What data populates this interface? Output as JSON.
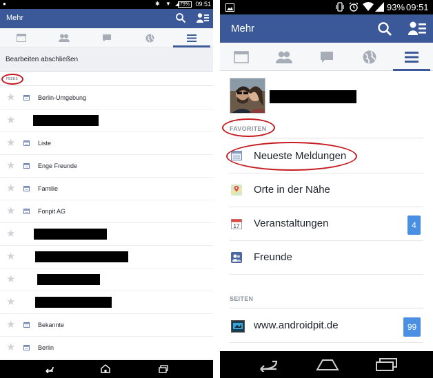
{
  "left": {
    "status": {
      "time": "09:51",
      "battery": "79%"
    },
    "appbar": {
      "title": "Mehr"
    },
    "edit_label": "Bearbeiten abschließen",
    "feeds_header": "FEEDS",
    "feeds": [
      {
        "label": "Berlin-Umgebung",
        "redacted": false
      },
      {
        "label": "",
        "redacted": true
      },
      {
        "label": "Liste",
        "redacted": false
      },
      {
        "label": "Enge Freunde",
        "redacted": false
      },
      {
        "label": "Familie",
        "redacted": false
      },
      {
        "label": "Fonpit AG",
        "redacted": false
      },
      {
        "label": "",
        "redacted": true
      },
      {
        "label": "",
        "redacted": true
      },
      {
        "label": "",
        "redacted": true
      },
      {
        "label": "",
        "redacted": true
      },
      {
        "label": "Bekannte",
        "redacted": false
      },
      {
        "label": "Berlin",
        "redacted": false
      }
    ]
  },
  "right": {
    "status": {
      "battery_pct": "93%",
      "time": "09:51"
    },
    "appbar": {
      "title": "Mehr"
    },
    "favorites_header": "FAVORITEN",
    "favorites": [
      {
        "label": "Neueste Meldungen",
        "icon": "news-feed-icon",
        "badge": ""
      },
      {
        "label": "Orte in der Nähe",
        "icon": "map-pin-icon",
        "badge": ""
      },
      {
        "label": "Veranstaltungen",
        "icon": "calendar-icon",
        "badge": "4"
      },
      {
        "label": "Freunde",
        "icon": "friends-icon",
        "badge": ""
      }
    ],
    "pages_header": "SEITEN",
    "pages": [
      {
        "label": "www.androidpit.de",
        "icon": "page-icon",
        "badge": "99"
      }
    ],
    "calendar_day": "17"
  },
  "colors": {
    "facebook_blue": "#3b5998",
    "badge_blue": "#4a90e2",
    "annotation_red": "#c41a1f"
  }
}
